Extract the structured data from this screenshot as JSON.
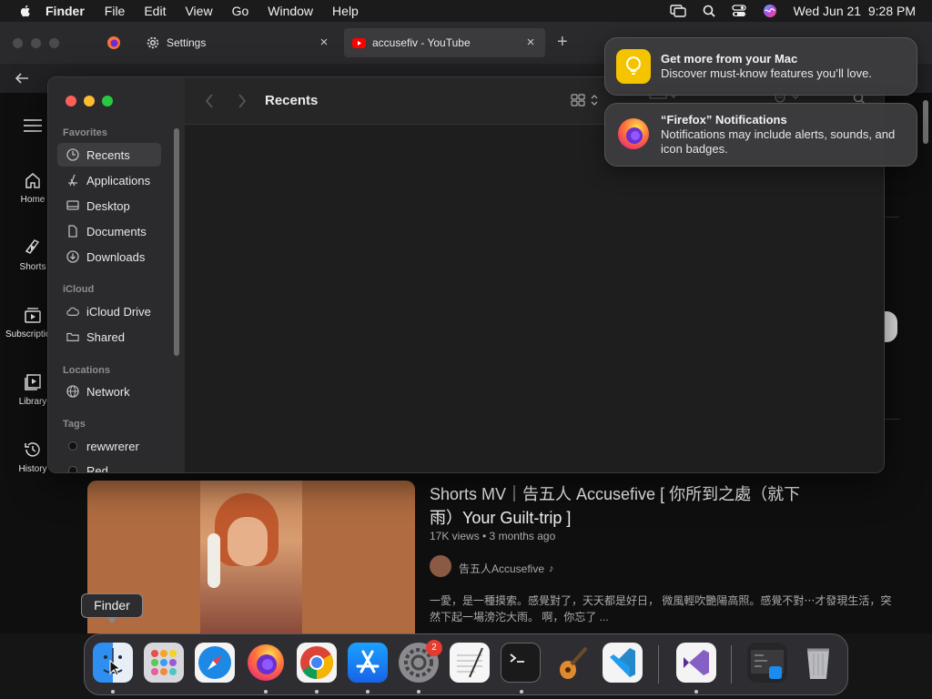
{
  "menubar": {
    "app_name": "Finder",
    "items": [
      "File",
      "Edit",
      "View",
      "Go",
      "Window",
      "Help"
    ],
    "datetime": "Wed Jun 21  9:28 PM"
  },
  "browser": {
    "tabs": [
      {
        "label": "Settings"
      },
      {
        "label": "accusefiv - YouTube"
      }
    ]
  },
  "youtube_sidebar": [
    {
      "label": "Home",
      "icon": "home-icon"
    },
    {
      "label": "Shorts",
      "icon": "shorts-icon"
    },
    {
      "label": "Subscriptions",
      "icon": "subscriptions-icon"
    },
    {
      "label": "Library",
      "icon": "library-icon"
    },
    {
      "label": "History",
      "icon": "history-icon"
    }
  ],
  "finder": {
    "title": "Recents",
    "sections": {
      "favorites": "Favorites",
      "icloud": "iCloud",
      "locations": "Locations",
      "tags": "Tags"
    },
    "favorites": [
      "Recents",
      "Applications",
      "Desktop",
      "Documents",
      "Downloads"
    ],
    "icloud": [
      "iCloud Drive",
      "Shared"
    ],
    "locations": [
      "Network"
    ],
    "tags": [
      "rewwrerer",
      "Red"
    ]
  },
  "notifications": [
    {
      "title": "Get more from your Mac",
      "body": "Discover must-know features you’ll love.",
      "icon": "tips-icon",
      "color": "#f5c400"
    },
    {
      "title": "“Firefox” Notifications",
      "body": "Notifications may include alerts, sounds, and icon badges.",
      "icon": "firefox-icon"
    }
  ],
  "video": {
    "title_line1": "Shorts MV｜告五人 Accusefive [ 你所到之處（就下",
    "title_line2": "雨）Your Guilt-trip ]",
    "meta": "17K views • 3 months ago",
    "channel": "告五人Accusefive",
    "desc_line1": "一愛，是一種摸索。感覺對了，天天都是好日， 微風輕吹艷陽高照。感覺不對⋯才發現生活，突",
    "desc_line2": "然下起一場滂沱大雨。 啊，你忘了 ..."
  },
  "dock": {
    "tooltip": "Finder",
    "settings_badge": "2",
    "apps": [
      "Finder",
      "Launchpad",
      "Safari",
      "Firefox",
      "Chrome",
      "App Store",
      "System Settings",
      "TextEdit",
      "Terminal",
      "GarageBand",
      "Visual Studio Code",
      "Visual Studio",
      "Preview",
      "Trash"
    ]
  }
}
